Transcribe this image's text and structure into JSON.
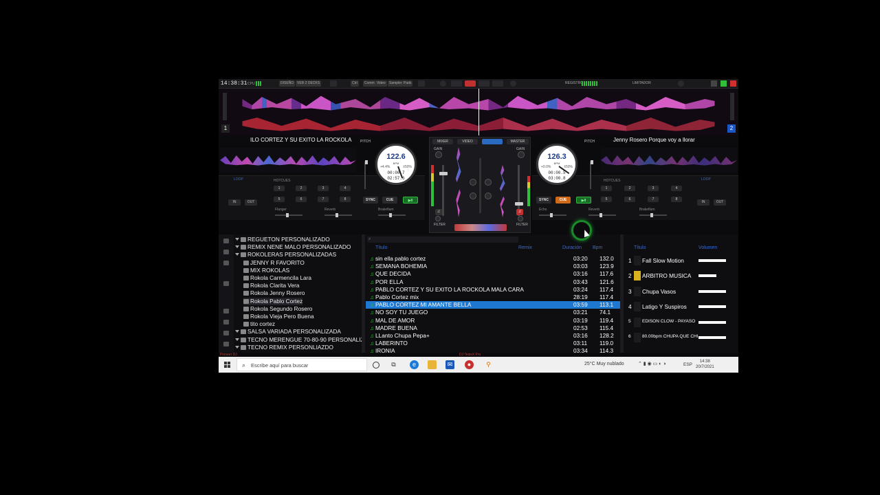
{
  "topbar": {
    "clock": "14:38:31",
    "cpu_label": "CPU",
    "buttons": [
      "DISEÑO",
      "VER 2 DECKS",
      "Ctrl",
      "Comm",
      "Video",
      "Sampler",
      "Pads",
      "REGISTRO",
      "LIMITADOR"
    ]
  },
  "waveform": {
    "deck1_number": "1",
    "deck2_number": "2"
  },
  "deck1": {
    "title": "ILO CORTEZ Y SU EXITO LA ROCKOLA",
    "pitch_label": "PITCH",
    "bpm": "122.6",
    "bpm_label": "BPM",
    "pitch_pct": "+4.4%",
    "range": "±50%",
    "time_elapsed": "00:00.7",
    "time_remaining": "02:57.6",
    "loop_label": "LOOP",
    "hotcues_label": "HOTCUES",
    "hotcues": [
      "1",
      "2",
      "3",
      "4",
      "5",
      "6",
      "7",
      "8"
    ],
    "in_label": "IN",
    "out_label": "OUT",
    "sync_label": "SYNC",
    "cue_label": "CUE",
    "play_label": "▶II",
    "fx": [
      "Flanger",
      "Reverb",
      "Brakeflam"
    ]
  },
  "deck2": {
    "title": "Jenny Rosero  Porque voy a llorar",
    "pitch_label": "PITCH",
    "bpm": "126.3",
    "bpm_label": "BPM",
    "pitch_pct": "+0.0%",
    "range": "±50%",
    "time_elapsed": "00:00.5",
    "time_remaining": "03:00.8",
    "loop_label": "LOOP",
    "hotcues_label": "HOTCUES",
    "hotcues": [
      "1",
      "2",
      "3",
      "4",
      "5",
      "6",
      "7",
      "8"
    ],
    "in_label": "IN",
    "out_label": "OUT",
    "sync_label": "SYNC",
    "cue_label": "CUE",
    "play_label": "▶II",
    "fx": [
      "Echo",
      "Reverb",
      "Brakeflam"
    ]
  },
  "mixer": {
    "tabs": [
      "MIXER",
      "VIDEO",
      "MASTER"
    ],
    "gain_label": "GAIN",
    "filter_label": "FILTER"
  },
  "tree": [
    {
      "label": "REGUETON PERSONALIZADO",
      "level": 0,
      "expanded": true
    },
    {
      "label": "REMIX NENE MALO PERSONALIZADO",
      "level": 0
    },
    {
      "label": "ROKOLERAS PERSONALIZADAS",
      "level": 0,
      "expanded": true
    },
    {
      "label": "JENNY R FAVORITO",
      "level": 1
    },
    {
      "label": "MIX ROKOLAS",
      "level": 1
    },
    {
      "label": "Rokola Carmencila Lara",
      "level": 1
    },
    {
      "label": "Rokola Clarita Vera",
      "level": 1
    },
    {
      "label": "Rokola Jenny Rosero",
      "level": 1
    },
    {
      "label": "Rokola Pablo Cortez",
      "level": 1,
      "selected": true
    },
    {
      "label": "Rokola Segundo Rosero",
      "level": 1
    },
    {
      "label": "Rokola Vieja Pero Buena",
      "level": 1
    },
    {
      "label": "tito cortez",
      "level": 1
    },
    {
      "label": "SALSA VARIADA PERSONALIZADA",
      "level": 0
    },
    {
      "label": "TECNO MERENGUE 70-80-90 PERSONALIZ",
      "level": 0
    },
    {
      "label": "TECNO REMIX  PERSONLIAZDO",
      "level": 0
    }
  ],
  "tracklist": {
    "headers": {
      "title": "Título",
      "remix": "Remix",
      "duration": "Duración",
      "bpm": "Bpm"
    },
    "rows": [
      {
        "title": "sin ella pablo cortez",
        "duration": "03:20",
        "bpm": "132.0"
      },
      {
        "title": "SEMANA BOHEMIA",
        "duration": "03:03",
        "bpm": "123.9"
      },
      {
        "title": "QUE DECIDA",
        "duration": "03:16",
        "bpm": "117.6"
      },
      {
        "title": "POR ELLA",
        "duration": "03:43",
        "bpm": "121.6"
      },
      {
        "title": "PABLO CORTEZ Y SU EXITO LA ROCKOLA  MALA CARA",
        "duration": "03:24",
        "bpm": "117.4"
      },
      {
        "title": "Pablo Cortez mix",
        "duration": "28:19",
        "bpm": "117.4"
      },
      {
        "title": "PABLO CORTEZ MI AMANTE BELLA",
        "duration": "03:59",
        "bpm": "113.1",
        "highlighted": true
      },
      {
        "title": "NO SOY TU JUEGO",
        "duration": "03:21",
        "bpm": "74.1"
      },
      {
        "title": "MAL DE AMOR",
        "duration": "03:19",
        "bpm": "119.4"
      },
      {
        "title": "MADRE BUENA",
        "duration": "02:53",
        "bpm": "115.4"
      },
      {
        "title": "LLanto Chupa Pepa+",
        "duration": "03:16",
        "bpm": "128.2"
      },
      {
        "title": "LABERINTO",
        "duration": "03:11",
        "bpm": "119.0"
      },
      {
        "title": "IRONIA",
        "duration": "03:34",
        "bpm": "114.3"
      }
    ]
  },
  "sampler": {
    "headers": {
      "title": "Título",
      "volume": "Volumen"
    },
    "rows": [
      {
        "num": "1",
        "title": "Fall Slow Motion"
      },
      {
        "num": "2",
        "title": "ARBITRO MUSICA"
      },
      {
        "num": "3",
        "title": "Chupa Vasos"
      },
      {
        "num": "4",
        "title": "Latigo Y Suspiros"
      },
      {
        "num": "5",
        "title": "EDISON CLOW - PAYASO",
        "small": true
      },
      {
        "num": "6",
        "title": "80.00bpm CHUPA QUE CHI",
        "small": true
      }
    ]
  },
  "status": {
    "left": "Pioneer DJ",
    "center": "DJ TesisX Pro"
  },
  "taskbar": {
    "search_placeholder": "Escribe aquí para buscar",
    "weather": "25°C  Muy nublado",
    "lang": "ESP",
    "time": "14:38",
    "date": "20/7/2021"
  },
  "colors": {
    "accent_blue": "#1e78d2",
    "play_green": "#2fbf3a",
    "cue_orange": "#d06a1a",
    "wave_purple": "#c04ab0"
  }
}
